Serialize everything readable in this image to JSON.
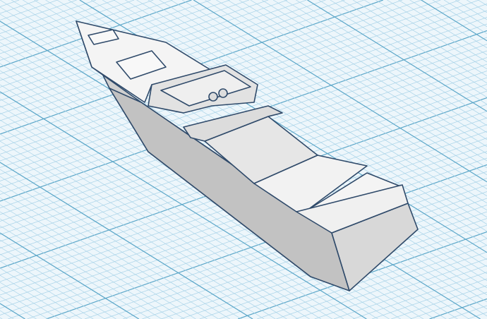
{
  "workplane": {
    "background": "#edf6fb",
    "minor_grid_color": "#a8d3e8",
    "major_grid_color": "#5aa6c8"
  },
  "model": {
    "name": "boat",
    "outline_color": "#2f4a6a",
    "top_color": "#f4f4f4",
    "side_color": "#cfcfcf",
    "stern_color": "#dadada",
    "interior_color": "#e6e6e6"
  }
}
